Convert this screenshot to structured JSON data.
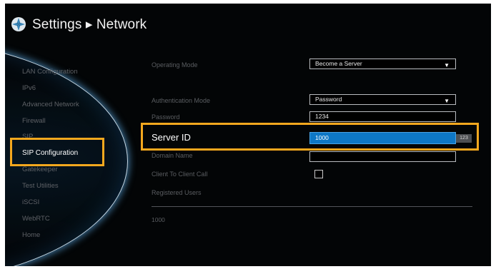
{
  "header": {
    "title": "Settings ▸ Network",
    "logo_icon": "settings-wheel-icon"
  },
  "sidebar": {
    "items": [
      {
        "label": "LAN Configuration"
      },
      {
        "label": "IPv6"
      },
      {
        "label": "Advanced Network"
      },
      {
        "label": "Firewall"
      },
      {
        "label": "SIP"
      },
      {
        "label": "SIP Configuration",
        "active": true
      },
      {
        "label": "Gatekeeper"
      },
      {
        "label": "Test Utilities"
      },
      {
        "label": "iSCSI"
      },
      {
        "label": "WebRTC"
      },
      {
        "label": "Home"
      }
    ]
  },
  "form": {
    "operating_mode": {
      "label": "Operating Mode",
      "value": "Become a Server"
    },
    "authentication_mode": {
      "label": "Authentication Mode",
      "value": "Password"
    },
    "password": {
      "label": "Password",
      "value": "1234"
    },
    "server_id": {
      "label": "Server ID",
      "value": "1000",
      "input_badge": "123"
    },
    "domain_name": {
      "label": "Domain Name",
      "value": ""
    },
    "client_to_client_call": {
      "label": "Client To Client Call",
      "checked": false
    },
    "registered_users": {
      "label": "Registered Users",
      "list": [
        "1000"
      ]
    }
  },
  "colors": {
    "highlight_frame": "#f5a81e",
    "active_field": "#0d77c6",
    "background": "#030506"
  }
}
